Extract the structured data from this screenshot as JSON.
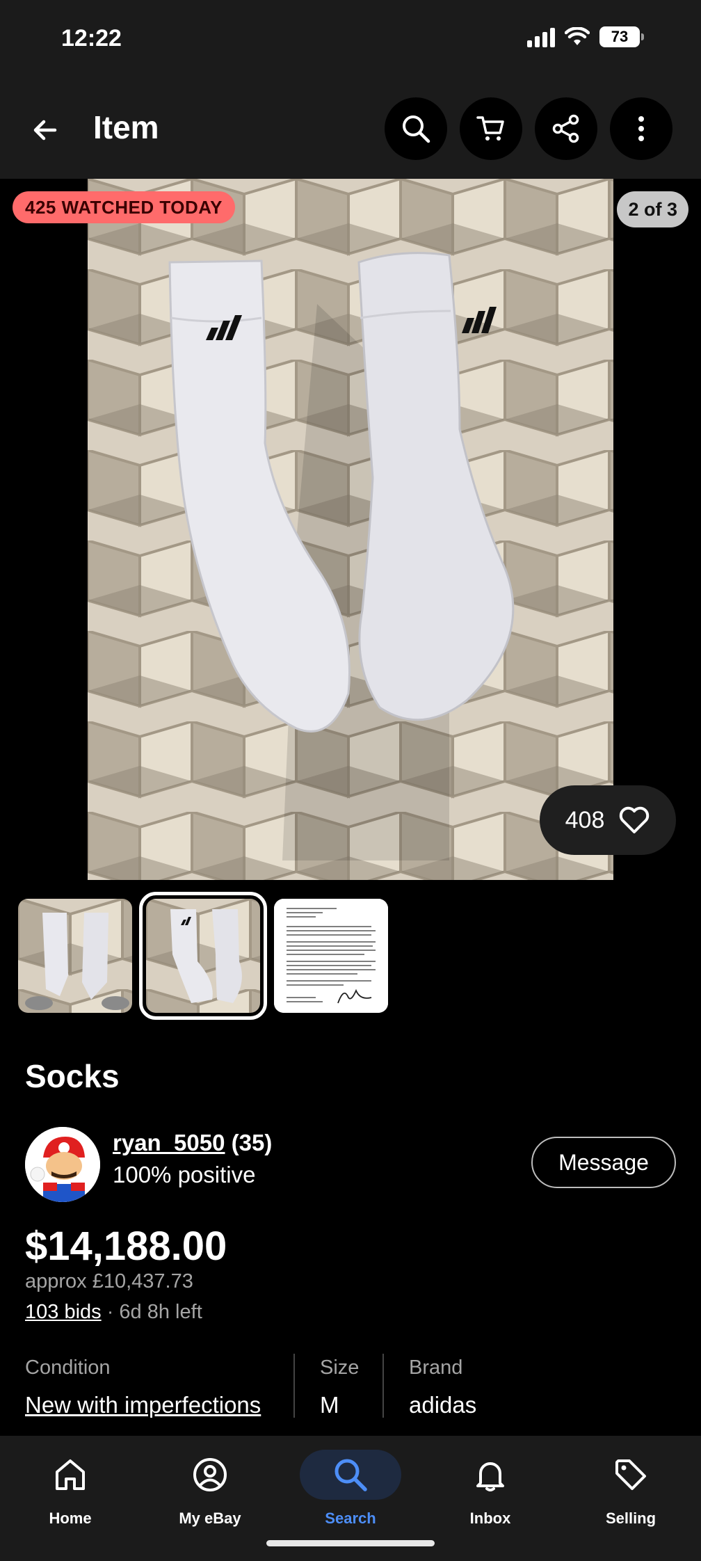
{
  "status_bar": {
    "time": "12:22",
    "battery": "73"
  },
  "header": {
    "title": "Item"
  },
  "gallery": {
    "watched_badge": "425 WATCHED TODAY",
    "counter": "2 of 3",
    "watch_count": "408"
  },
  "item": {
    "title": "Socks"
  },
  "seller": {
    "name": "ryan_5050",
    "feedback_count": "(35)",
    "positive": "100% positive",
    "message_label": "Message"
  },
  "price": {
    "amount": "$14,188.00",
    "approx": "approx £10,437.73",
    "bids": "103 bids",
    "time_left": "· 6d 8h left"
  },
  "specifics": [
    {
      "label": "Condition",
      "value": "New with imperfections"
    },
    {
      "label": "Size",
      "value": "M"
    },
    {
      "label": "Brand",
      "value": "adidas"
    }
  ],
  "bottom_nav": [
    {
      "label": "Home",
      "icon": "home-icon"
    },
    {
      "label": "My eBay",
      "icon": "user-icon"
    },
    {
      "label": "Search",
      "icon": "search-icon",
      "active": true
    },
    {
      "label": "Inbox",
      "icon": "bell-icon"
    },
    {
      "label": "Selling",
      "icon": "tag-icon"
    }
  ],
  "colors": {
    "badge_red": "#ff6b6b",
    "active_blue": "#4d8ef7",
    "bar_bg": "#1b1b1b"
  }
}
